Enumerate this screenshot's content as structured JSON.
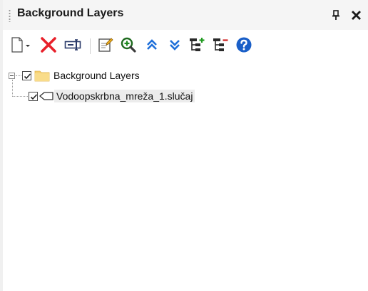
{
  "panel": {
    "title": "Background Layers"
  },
  "toolbar": {
    "buttons": [
      {
        "name": "new-layer",
        "icon": "new-document-icon",
        "has_dropdown": true
      },
      {
        "name": "remove-layer",
        "icon": "red-x-icon",
        "color": "#e8202a"
      },
      {
        "name": "rename-layer",
        "icon": "rename-icon"
      },
      {
        "name": "layer-properties",
        "icon": "edit-properties-icon"
      },
      {
        "name": "zoom-to-layer",
        "icon": "zoom-in-icon",
        "color": "#1e8a1e"
      },
      {
        "name": "move-up",
        "icon": "double-chevron-up-icon",
        "color": "#1e6fd9"
      },
      {
        "name": "move-down",
        "icon": "double-chevron-down-icon",
        "color": "#1e6fd9"
      },
      {
        "name": "expand-all",
        "icon": "expand-tree-icon"
      },
      {
        "name": "collapse-all",
        "icon": "collapse-tree-icon"
      },
      {
        "name": "help",
        "icon": "help-icon",
        "color": "#1a5fc8"
      }
    ]
  },
  "tree": {
    "root": {
      "label": "Background Layers",
      "checked": true,
      "expanded": true,
      "icon": "folder-icon"
    },
    "children": [
      {
        "label": "Vodoopskrbna_mreža_1.slučaj",
        "checked": true,
        "icon": "diamond-outline-icon",
        "selected": true
      }
    ]
  }
}
